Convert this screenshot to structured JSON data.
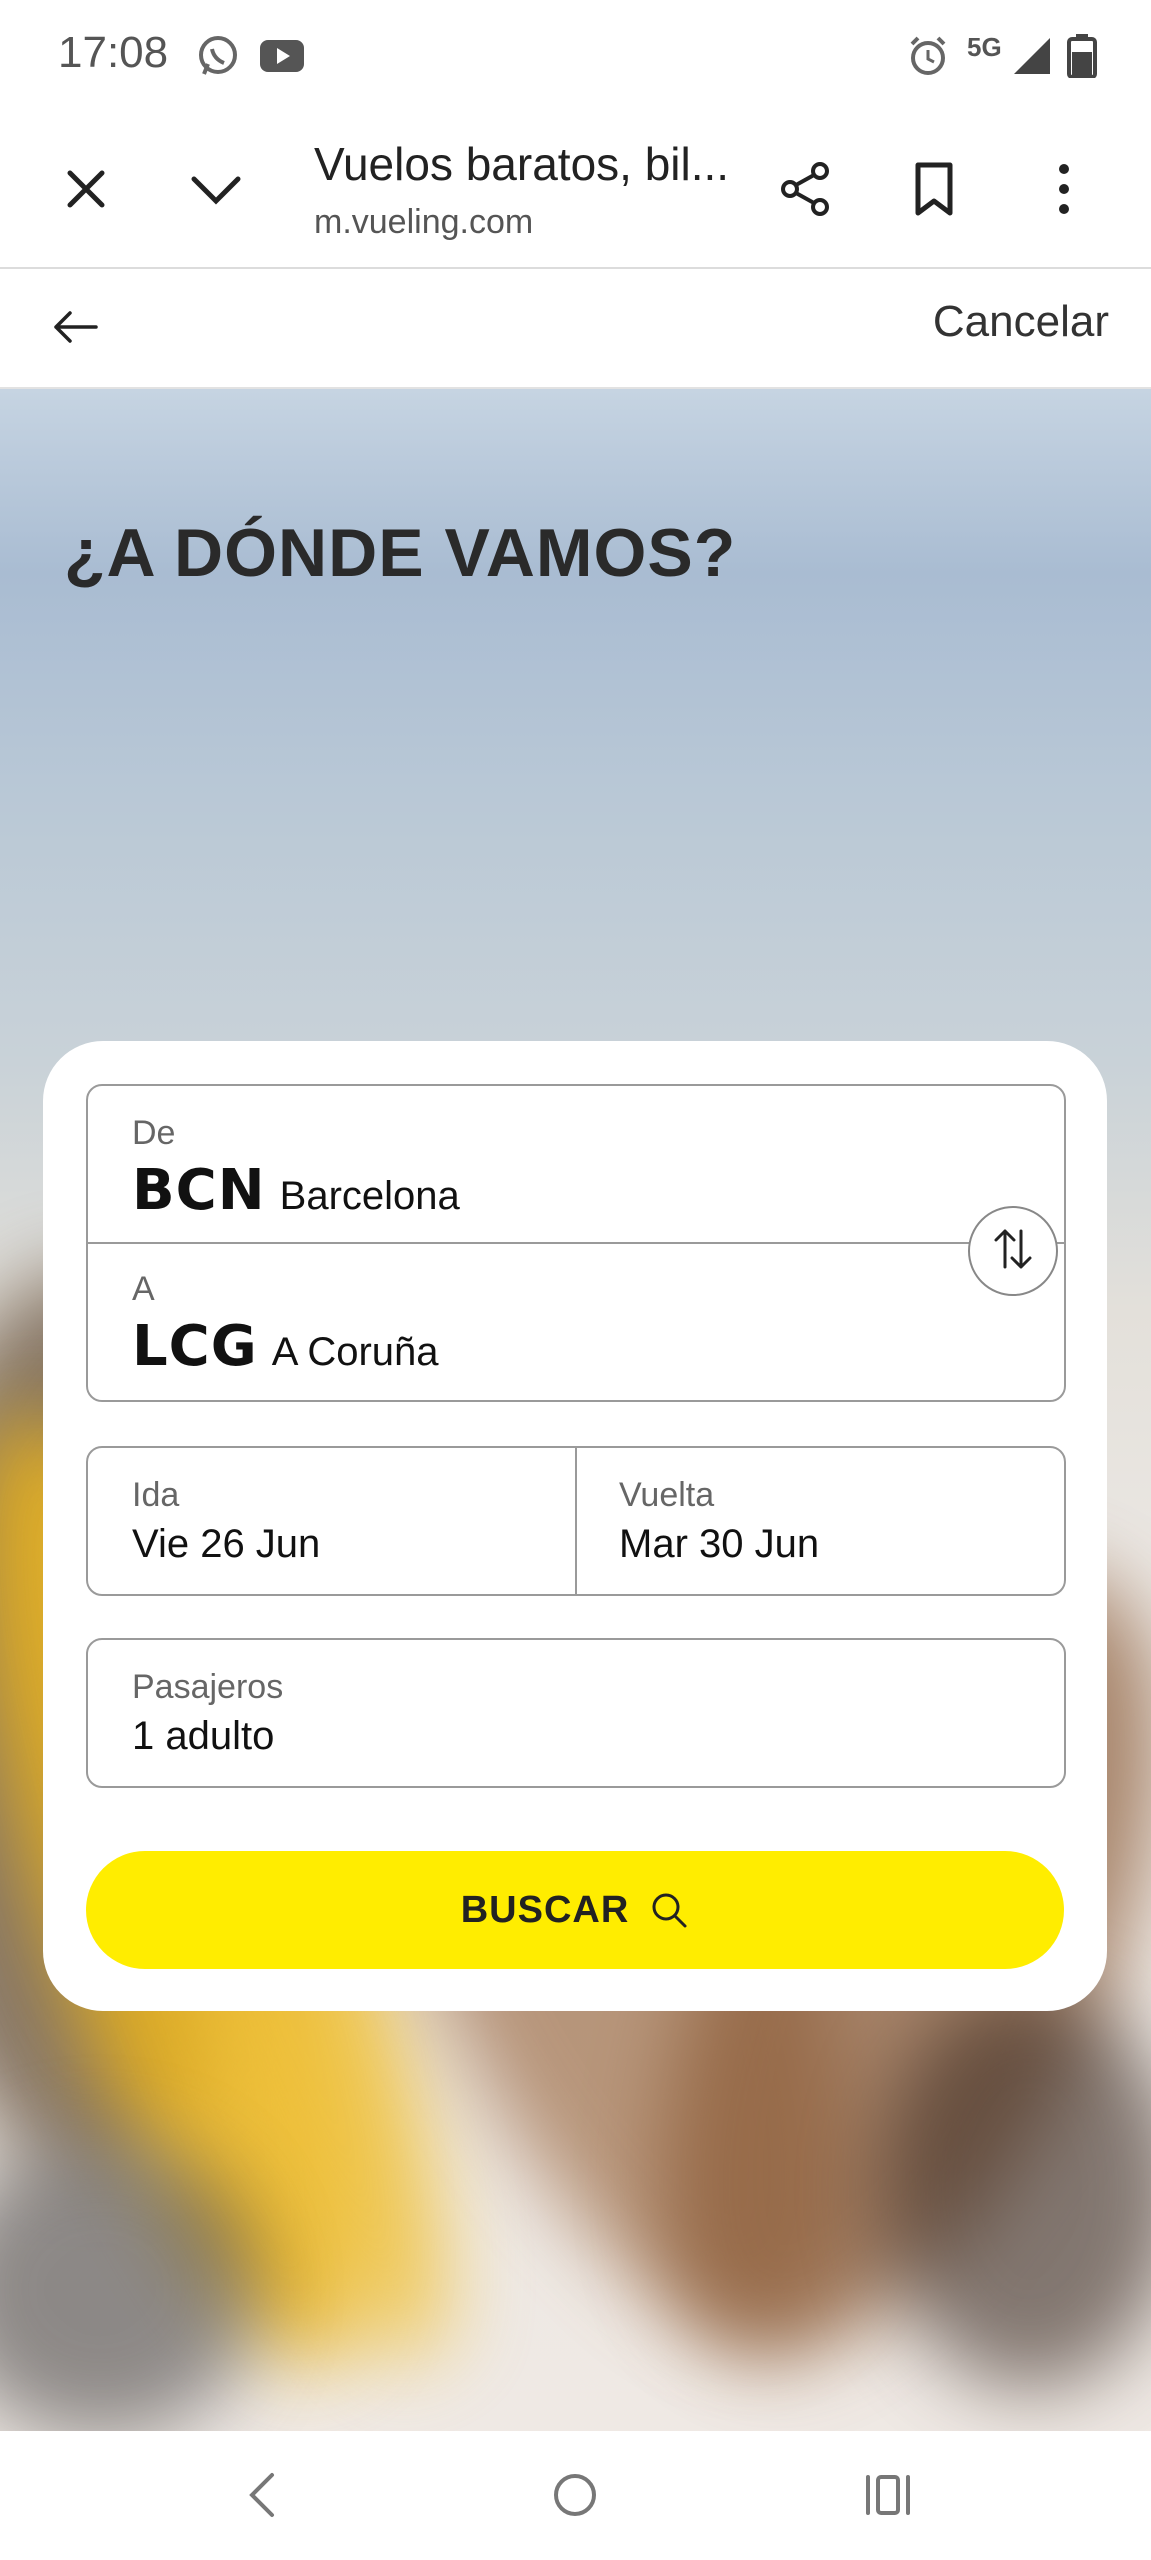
{
  "status_bar": {
    "time": "17:08",
    "network": "5G",
    "icons": [
      "whatsapp-icon",
      "youtube-icon",
      "alarm-icon",
      "signal-icon",
      "battery-icon"
    ]
  },
  "browser": {
    "page_title": "Vuelos baratos, bil...",
    "url": "m.vueling.com",
    "icons": [
      "close-icon",
      "chevron-down-icon",
      "share-icon",
      "bookmark-icon",
      "more-vert-icon"
    ]
  },
  "header": {
    "cancel_label": "Cancelar"
  },
  "hero": {
    "title": "¿A DÓNDE VAMOS?"
  },
  "form": {
    "origin": {
      "label": "De",
      "code": "BCN",
      "city": "Barcelona"
    },
    "destination": {
      "label": "A",
      "code": "LCG",
      "city": "A Coruña"
    },
    "outbound": {
      "label": "Ida",
      "value": "Vie 26 Jun"
    },
    "return": {
      "label": "Vuelta",
      "value": "Mar 30 Jun"
    },
    "passengers": {
      "label": "Pasajeros",
      "value": "1 adulto"
    },
    "search_label": "BUSCAR"
  },
  "colors": {
    "accent": "#ffed00",
    "text": "#1a1a1a"
  }
}
